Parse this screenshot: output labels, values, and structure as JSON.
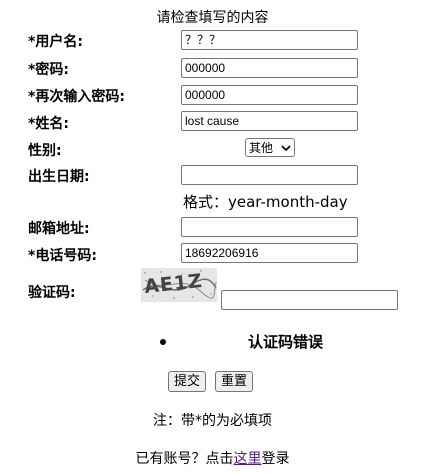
{
  "header": {
    "title": "请检查填写的内容"
  },
  "form": {
    "username": {
      "label": "*用户名:",
      "value": "？？？"
    },
    "password": {
      "label": "*密码:",
      "value": "000000"
    },
    "password_confirm": {
      "label": "*再次输入密码:",
      "value": "000000"
    },
    "name": {
      "label": "*姓名:",
      "value": "lost cause"
    },
    "gender": {
      "label": "性别:",
      "selected": "其他"
    },
    "birthday": {
      "label": "出生日期:",
      "value": "",
      "hint": "格式：year-month-day"
    },
    "email": {
      "label": "邮箱地址:",
      "value": ""
    },
    "phone": {
      "label": "*电话号码:",
      "value": "18692206916"
    },
    "captcha": {
      "label": "验证码:",
      "image_text": "AE1Z",
      "value": ""
    }
  },
  "error": {
    "message": "认证码错误"
  },
  "buttons": {
    "submit": "提交",
    "reset": "重置"
  },
  "note": "注：带*的为必填项",
  "login": {
    "prefix": "已有账号？点击",
    "link": "这里",
    "suffix": "登录"
  },
  "colors": {
    "link": "#551a8b",
    "button_bg": "#efefef",
    "border": "#767676"
  }
}
